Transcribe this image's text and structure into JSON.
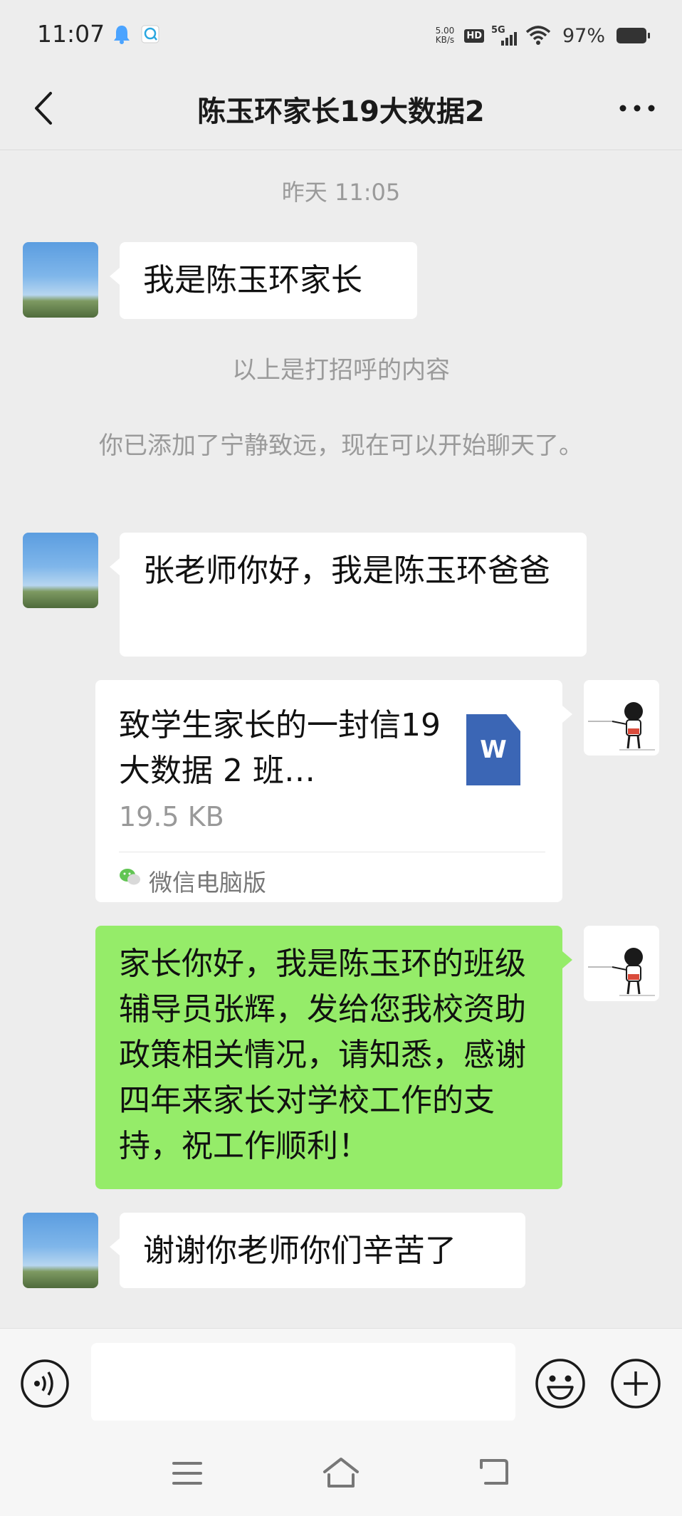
{
  "status_bar": {
    "time": "11:07",
    "net_speed_value": "5.00",
    "net_speed_unit": "KB/s",
    "hd_badge": "HD",
    "network": "5G",
    "battery_percent": "97%",
    "battery_level": 0.97
  },
  "header": {
    "title": "陈玉环家长19大数据2"
  },
  "messages": {
    "time_divider": "昨天 11:05",
    "msg1": "我是陈玉环家长",
    "greeting_note": "以上是打招呼的内容",
    "added_note": "你已添加了宁静致远，现在可以开始聊天了。",
    "msg2": "张老师你好，我是陈玉环爸爸",
    "file": {
      "name": "致学生家长的一封信19 大数据 2 班…",
      "size": "19.5 KB",
      "source": "微信电脑版",
      "icon_letter": "W"
    },
    "msg3": "家长你好，我是陈玉环的班级辅导员张辉，发给您我校资助政策相关情况，请知悉，感谢四年来家长对学校工作的支持，祝工作顺利！",
    "msg4": "谢谢你老师你们辛苦了"
  },
  "input_bar": {
    "placeholder": ""
  },
  "colors": {
    "background": "#ededed",
    "bubble_out": "#95ec69",
    "bubble_in": "#ffffff",
    "file_icon": "#3b66b5"
  }
}
